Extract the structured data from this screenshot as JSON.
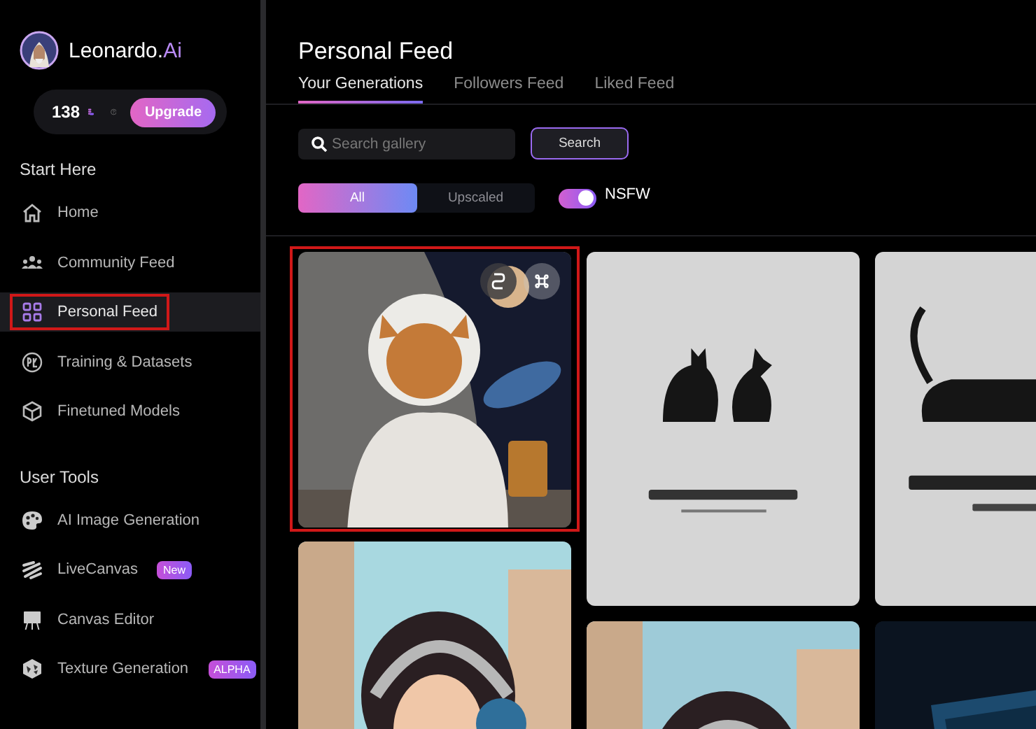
{
  "brand": {
    "name": "Leonardo.",
    "accent": "Ai"
  },
  "credits": {
    "count": "138",
    "upgrade": "Upgrade"
  },
  "sidebar": {
    "sections": [
      {
        "title": "Start Here",
        "items": [
          {
            "label": "Home",
            "selected": false,
            "highlighted": false
          },
          {
            "label": "Community Feed",
            "selected": false,
            "highlighted": false
          },
          {
            "label": "Personal Feed",
            "selected": true,
            "highlighted": true
          },
          {
            "label": "Training & Datasets",
            "selected": false,
            "highlighted": false
          },
          {
            "label": "Finetuned Models",
            "selected": false,
            "highlighted": false
          }
        ]
      },
      {
        "title": "User Tools",
        "items": [
          {
            "label": "AI Image Generation",
            "selected": false,
            "highlighted": false
          },
          {
            "label": "LiveCanvas",
            "selected": false,
            "highlighted": false,
            "badge": "New"
          },
          {
            "label": "Canvas Editor",
            "selected": false,
            "highlighted": false
          },
          {
            "label": "Texture Generation",
            "selected": false,
            "highlighted": false,
            "badge": "ALPHA"
          }
        ]
      }
    ]
  },
  "page": {
    "title": "Personal Feed"
  },
  "tabs": [
    {
      "label": "Your Generations",
      "selected": true
    },
    {
      "label": "Followers Feed",
      "selected": false
    },
    {
      "label": "Liked Feed",
      "selected": false
    }
  ],
  "search": {
    "placeholder": "Search gallery",
    "button": "Search"
  },
  "filter": [
    {
      "label": "All",
      "selected": true
    },
    {
      "label": "Upscaled",
      "selected": false
    }
  ],
  "nsfw": {
    "label": "NSFW",
    "on": true
  },
  "gallery": [
    {
      "items": [
        {
          "kind": "picture",
          "highlighted": true
        },
        {
          "kind": "picture",
          "highlighted": false
        }
      ]
    },
    {
      "items": [
        {
          "kind": "picture",
          "highlighted": false
        },
        {
          "kind": "picture",
          "highlighted": false
        }
      ]
    },
    {
      "items": [
        {
          "kind": "picture",
          "highlighted": false
        },
        {
          "kind": "picture",
          "highlighted": false
        }
      ]
    }
  ]
}
